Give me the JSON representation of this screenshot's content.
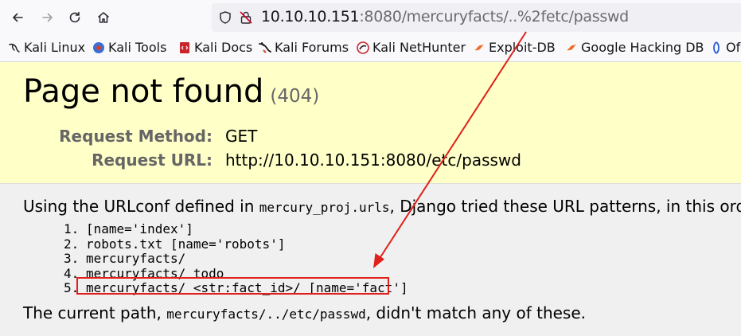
{
  "browser": {
    "url": {
      "host": "10.10.10.151",
      "rest": ":8080/mercuryfacts/..%2fetc/passwd"
    },
    "bookmarks": [
      {
        "label": "Kali Linux",
        "icon": "kali-dragon-icon"
      },
      {
        "label": "Kali Tools",
        "icon": "kali-tools-icon"
      },
      {
        "label": "Kali Docs",
        "icon": "kali-docs-icon"
      },
      {
        "label": "Kali Forums",
        "icon": "kali-forums-icon"
      },
      {
        "label": "Kali NetHunter",
        "icon": "nethunter-icon"
      },
      {
        "label": "Exploit-DB",
        "icon": "exploit-db-icon"
      },
      {
        "label": "Google Hacking DB",
        "icon": "ghdb-icon"
      },
      {
        "label": "Of",
        "icon": "offsec-icon"
      }
    ]
  },
  "page": {
    "title": "Page not found",
    "status": "(404)",
    "request_method_label": "Request Method:",
    "request_method": "GET",
    "request_url_label": "Request URL:",
    "request_url": "http://10.10.10.151:8080/etc/passwd",
    "intro_prefix": "Using the URLconf defined in ",
    "urlconf": "mercury_proj.urls",
    "intro_suffix": ", Django tried these URL patterns, in this order:",
    "patterns": [
      {
        "num": "1.",
        "text": "[name='index']"
      },
      {
        "num": "2.",
        "text": "robots.txt [name='robots']"
      },
      {
        "num": "3.",
        "text": "mercuryfacts/"
      },
      {
        "num": "4.",
        "text": "mercuryfacts/ todo"
      },
      {
        "num": "5.",
        "text": "mercuryfacts/ <str:fact_id>/ [name='fact']"
      }
    ],
    "current_prefix": "The current path, ",
    "current_path": "mercuryfacts/../etc/passwd",
    "current_suffix": ", didn't match any of these."
  },
  "annotation": {
    "color": "#e0201a"
  }
}
